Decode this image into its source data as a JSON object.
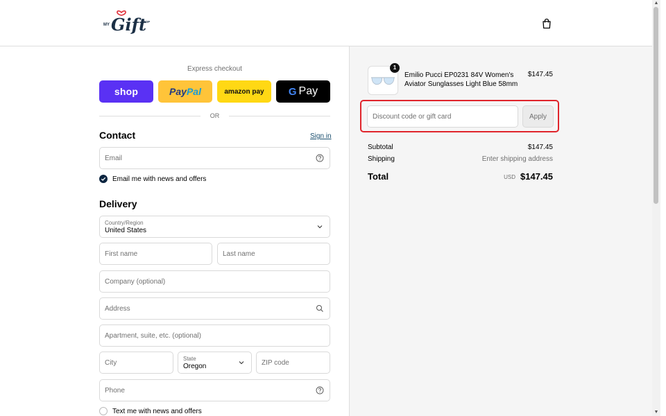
{
  "brand": {
    "logo_text_my": "MY",
    "logo_text_gift": "Gift",
    "logo_text_stop": "STOP"
  },
  "express": {
    "title": "Express checkout",
    "shop_label": "shop",
    "paypal_label_a": "Pay",
    "paypal_label_b": "Pal",
    "amazon_label": "amazon pay",
    "gpay_g": "G",
    "gpay_label": "Pay",
    "separator": "OR"
  },
  "contact": {
    "title": "Contact",
    "sign_in": "Sign in",
    "email_placeholder": "Email",
    "news_label": "Email me with news and offers",
    "news_checked": true
  },
  "delivery": {
    "title": "Delivery",
    "country_label": "Country/Region",
    "country_value": "United States",
    "first_name_placeholder": "First name",
    "last_name_placeholder": "Last name",
    "company_placeholder": "Company (optional)",
    "address_placeholder": "Address",
    "apartment_placeholder": "Apartment, suite, etc. (optional)",
    "city_placeholder": "City",
    "state_label": "State",
    "state_value": "Oregon",
    "zip_placeholder": "ZIP code",
    "phone_placeholder": "Phone",
    "text_label": "Text me with news and offers",
    "text_checked": false
  },
  "summary": {
    "item": {
      "quantity": "1",
      "name": "Emilio Pucci EP0231 84V Women's Aviator Sunglasses Light Blue 58mm",
      "price": "$147.45"
    },
    "discount_placeholder": "Discount code or gift card",
    "apply_label": "Apply",
    "subtotal_label": "Subtotal",
    "subtotal_value": "$147.45",
    "shipping_label": "Shipping",
    "shipping_value": "Enter shipping address",
    "total_label": "Total",
    "currency": "USD",
    "total_value": "$147.45"
  },
  "icons": {
    "bag": "shopping-bag-icon",
    "help": "question-circle-icon",
    "search": "search-icon",
    "chevron": "chevron-down-icon",
    "check": "check-icon"
  },
  "colors": {
    "accent": "#0b2540",
    "highlight": "#e0242b",
    "shop": "#5a31f4",
    "paypal": "#ffc439",
    "amazon": "#ffd814",
    "gpay": "#000000"
  }
}
